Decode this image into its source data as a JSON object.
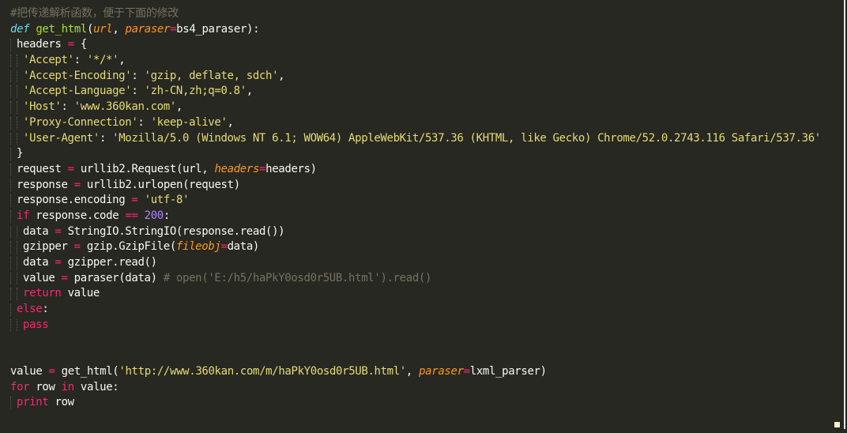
{
  "editor": {
    "lines": [
      {
        "parts": [
          {
            "c": "cmt",
            "t": "#把传递解析函数，便于下面的修改"
          }
        ]
      },
      {
        "parts": [
          {
            "c": "def",
            "t": "def"
          },
          {
            "c": "",
            "t": " "
          },
          {
            "c": "fn",
            "t": "get_html"
          },
          {
            "c": "",
            "t": "("
          },
          {
            "c": "param",
            "t": "url"
          },
          {
            "c": "",
            "t": ", "
          },
          {
            "c": "param",
            "t": "paraser"
          },
          {
            "c": "op",
            "t": "="
          },
          {
            "c": "",
            "t": "bs4_paraser):"
          }
        ]
      },
      {
        "indent": 1,
        "parts": [
          {
            "c": "",
            "t": "headers "
          },
          {
            "c": "op",
            "t": "="
          },
          {
            "c": "",
            "t": " {"
          }
        ]
      },
      {
        "indent": 2,
        "parts": [
          {
            "c": "str",
            "t": "'Accept'"
          },
          {
            "c": "",
            "t": ": "
          },
          {
            "c": "str",
            "t": "'*/*'"
          },
          {
            "c": "",
            "t": ","
          }
        ]
      },
      {
        "indent": 2,
        "parts": [
          {
            "c": "str",
            "t": "'Accept-Encoding'"
          },
          {
            "c": "",
            "t": ": "
          },
          {
            "c": "str",
            "t": "'gzip, deflate, sdch'"
          },
          {
            "c": "",
            "t": ","
          }
        ]
      },
      {
        "indent": 2,
        "parts": [
          {
            "c": "str",
            "t": "'Accept-Language'"
          },
          {
            "c": "",
            "t": ": "
          },
          {
            "c": "str",
            "t": "'zh-CN,zh;q=0.8'"
          },
          {
            "c": "",
            "t": ","
          }
        ]
      },
      {
        "indent": 2,
        "parts": [
          {
            "c": "str",
            "t": "'Host'"
          },
          {
            "c": "",
            "t": ": "
          },
          {
            "c": "str",
            "t": "'www.360kan.com'"
          },
          {
            "c": "",
            "t": ","
          }
        ]
      },
      {
        "indent": 2,
        "parts": [
          {
            "c": "str",
            "t": "'Proxy-Connection'"
          },
          {
            "c": "",
            "t": ": "
          },
          {
            "c": "str",
            "t": "'keep-alive'"
          },
          {
            "c": "",
            "t": ","
          }
        ]
      },
      {
        "indent": 2,
        "parts": [
          {
            "c": "str",
            "t": "'User-Agent'"
          },
          {
            "c": "",
            "t": ": "
          },
          {
            "c": "str",
            "t": "'Mozilla/5.0 (Windows NT 6.1; WOW64) AppleWebKit/537.36 (KHTML, like Gecko) Chrome/52.0.2743.116 Safari/537.36'"
          }
        ]
      },
      {
        "indent": 1,
        "parts": [
          {
            "c": "",
            "t": "}"
          }
        ]
      },
      {
        "indent": 1,
        "parts": [
          {
            "c": "",
            "t": "request "
          },
          {
            "c": "op",
            "t": "="
          },
          {
            "c": "",
            "t": " urllib2.Request(url, "
          },
          {
            "c": "param",
            "t": "headers"
          },
          {
            "c": "op",
            "t": "="
          },
          {
            "c": "",
            "t": "headers)"
          }
        ]
      },
      {
        "indent": 1,
        "parts": [
          {
            "c": "",
            "t": "response "
          },
          {
            "c": "op",
            "t": "="
          },
          {
            "c": "",
            "t": " urllib2.urlopen(request)"
          }
        ]
      },
      {
        "indent": 1,
        "parts": [
          {
            "c": "",
            "t": "response.encoding "
          },
          {
            "c": "op",
            "t": "="
          },
          {
            "c": "",
            "t": " "
          },
          {
            "c": "str",
            "t": "'utf-8'"
          }
        ]
      },
      {
        "indent": 1,
        "parts": [
          {
            "c": "kw",
            "t": "if"
          },
          {
            "c": "",
            "t": " response.code "
          },
          {
            "c": "op",
            "t": "=="
          },
          {
            "c": "",
            "t": " "
          },
          {
            "c": "num",
            "t": "200"
          },
          {
            "c": "",
            "t": ":"
          }
        ]
      },
      {
        "indent": 2,
        "parts": [
          {
            "c": "",
            "t": "data "
          },
          {
            "c": "op",
            "t": "="
          },
          {
            "c": "",
            "t": " StringIO.StringIO(response.read())"
          }
        ]
      },
      {
        "indent": 2,
        "parts": [
          {
            "c": "",
            "t": "gzipper "
          },
          {
            "c": "op",
            "t": "="
          },
          {
            "c": "",
            "t": " gzip.GzipFile("
          },
          {
            "c": "param",
            "t": "fileobj"
          },
          {
            "c": "op",
            "t": "="
          },
          {
            "c": "",
            "t": "data)"
          }
        ]
      },
      {
        "indent": 2,
        "parts": [
          {
            "c": "",
            "t": "data "
          },
          {
            "c": "op",
            "t": "="
          },
          {
            "c": "",
            "t": " gzipper.read()"
          }
        ]
      },
      {
        "indent": 2,
        "parts": [
          {
            "c": "",
            "t": "value "
          },
          {
            "c": "op",
            "t": "="
          },
          {
            "c": "",
            "t": " paraser(data) "
          },
          {
            "c": "cmt",
            "t": "# open('E:/h5/haPkY0osd0r5UB.html').read()"
          }
        ]
      },
      {
        "indent": 2,
        "parts": [
          {
            "c": "kw",
            "t": "return"
          },
          {
            "c": "",
            "t": " value"
          }
        ]
      },
      {
        "indent": 1,
        "parts": [
          {
            "c": "kw",
            "t": "else"
          },
          {
            "c": "",
            "t": ":"
          }
        ]
      },
      {
        "indent": 2,
        "parts": [
          {
            "c": "kw",
            "t": "pass"
          }
        ]
      },
      {
        "parts": []
      },
      {
        "parts": []
      },
      {
        "parts": [
          {
            "c": "",
            "t": "value "
          },
          {
            "c": "op",
            "t": "="
          },
          {
            "c": "",
            "t": " get_html("
          },
          {
            "c": "str",
            "t": "'http://www.360kan.com/m/haPkY0osd0r5UB.html'"
          },
          {
            "c": "",
            "t": ", "
          },
          {
            "c": "param",
            "t": "paraser"
          },
          {
            "c": "op",
            "t": "="
          },
          {
            "c": "",
            "t": "lxml_parser)"
          }
        ]
      },
      {
        "parts": [
          {
            "c": "kw",
            "t": "for"
          },
          {
            "c": "",
            "t": " row "
          },
          {
            "c": "kw",
            "t": "in"
          },
          {
            "c": "",
            "t": " value:"
          }
        ]
      },
      {
        "indent": 1,
        "parts": [
          {
            "c": "kw",
            "t": "print"
          },
          {
            "c": "",
            "t": " row"
          }
        ]
      }
    ]
  }
}
